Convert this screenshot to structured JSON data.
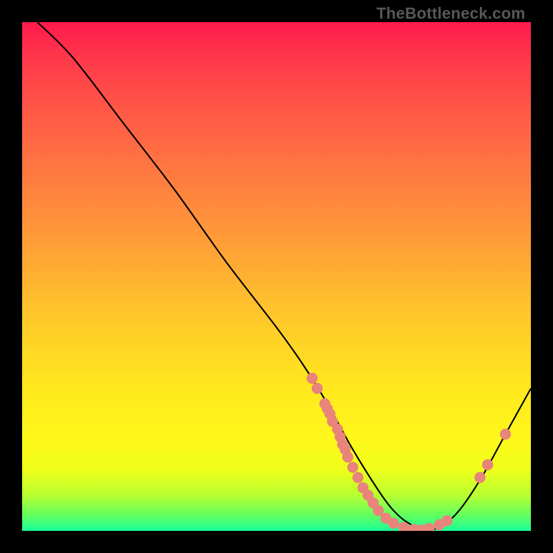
{
  "watermark": "TheBottleneck.com",
  "chart_data": {
    "type": "line",
    "title": "",
    "xlabel": "",
    "ylabel": "",
    "xlim": [
      0,
      100
    ],
    "ylim": [
      0,
      100
    ],
    "background": "rainbow-vertical-gradient",
    "series": [
      {
        "name": "bottleneck-curve",
        "color": "#000000",
        "x": [
          3,
          10,
          20,
          30,
          40,
          50,
          55,
          60,
          65,
          70,
          73,
          76,
          80,
          85,
          90,
          95,
          100
        ],
        "y": [
          100,
          93,
          80,
          67,
          53,
          40,
          33,
          25,
          16,
          8,
          4,
          1.5,
          0,
          3,
          10,
          19,
          28
        ]
      }
    ],
    "markers": {
      "name": "sample-points",
      "color": "#e8847a",
      "radius_px": 8,
      "points": [
        {
          "x": 57,
          "y": 30
        },
        {
          "x": 58,
          "y": 28
        },
        {
          "x": 59.5,
          "y": 25
        },
        {
          "x": 60,
          "y": 24
        },
        {
          "x": 60.5,
          "y": 23
        },
        {
          "x": 61,
          "y": 21.5
        },
        {
          "x": 62,
          "y": 20
        },
        {
          "x": 62.5,
          "y": 18.5
        },
        {
          "x": 63,
          "y": 17
        },
        {
          "x": 63.5,
          "y": 16
        },
        {
          "x": 64,
          "y": 14.5
        },
        {
          "x": 65,
          "y": 12.5
        },
        {
          "x": 66,
          "y": 10.5
        },
        {
          "x": 67,
          "y": 8.5
        },
        {
          "x": 68,
          "y": 7
        },
        {
          "x": 69,
          "y": 5.5
        },
        {
          "x": 70,
          "y": 4
        },
        {
          "x": 71.5,
          "y": 2.5
        },
        {
          "x": 73,
          "y": 1.5
        },
        {
          "x": 75,
          "y": 0.7
        },
        {
          "x": 77,
          "y": 0.3
        },
        {
          "x": 78.5,
          "y": 0.2
        },
        {
          "x": 80,
          "y": 0.5
        },
        {
          "x": 82,
          "y": 1.2
        },
        {
          "x": 83.5,
          "y": 2
        },
        {
          "x": 90,
          "y": 10.5
        },
        {
          "x": 91.5,
          "y": 13
        },
        {
          "x": 95,
          "y": 19
        }
      ]
    }
  }
}
